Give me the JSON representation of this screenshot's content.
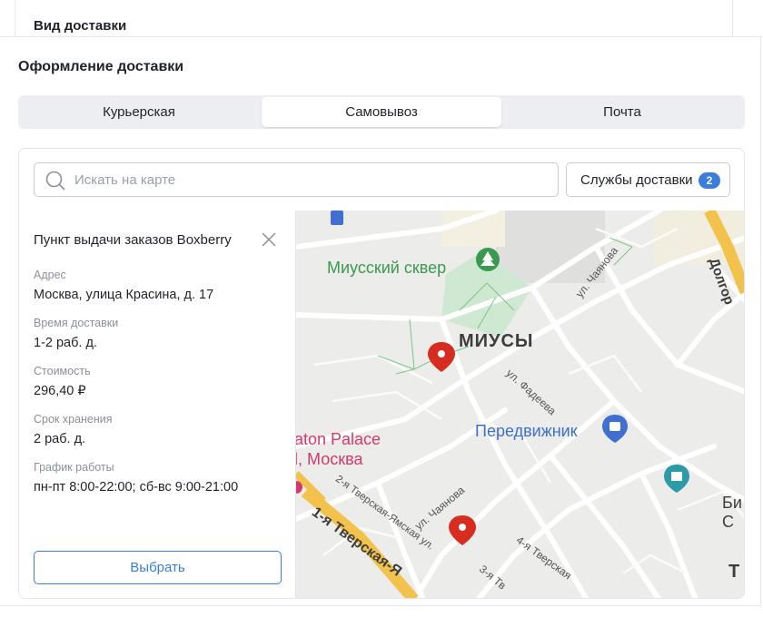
{
  "delivery_type_label": "Вид доставки",
  "section_title": "Оформление доставки",
  "tabs": [
    {
      "label": "Курьерская",
      "active": false
    },
    {
      "label": "Самовывоз",
      "active": true
    },
    {
      "label": "Почта",
      "active": false
    }
  ],
  "search": {
    "placeholder": "Искать на карте",
    "value": ""
  },
  "services_button": {
    "label": "Службы доставки",
    "count": "2"
  },
  "pickup": {
    "title": "Пункт выдачи заказов Boxberry",
    "fields": [
      {
        "label": "Адрес",
        "value": "Москва, улица Красина, д. 17"
      },
      {
        "label": "Время доставки",
        "value": "1-2 раб. д."
      },
      {
        "label": "Стоимость",
        "value": "296,40 ₽"
      },
      {
        "label": "Срок хранения",
        "value": "2 раб. д."
      },
      {
        "label": "График работы",
        "value": "пн-пт 8:00-22:00; сб-вс 9:00-21:00"
      }
    ],
    "choose_label": "Выбрать"
  },
  "map": {
    "labels": {
      "park": "Миусский сквер",
      "district": "МИУСЫ",
      "chayanova_1": "ул. Чаянова",
      "fadeeva": "ул. Фадеева",
      "store": "Передвижник",
      "hotel_1": "aton Palace",
      "hotel_2": "l, Москва",
      "tverskaya_2": "2-я Тверская-Ямская ул.",
      "chayanova_2": "ул. Чаянова",
      "tverskaya_1": "1-я Тверская-Я",
      "tverskaya_4": "4-я Тверская",
      "tverskaya_3": "3-я Тв",
      "dolgor": "Долгор",
      "bi_1": "Би",
      "bi_2": "С",
      "t": "Т"
    },
    "colors": {
      "park_green": "#3a9a4f",
      "marker_red": "#d62d20",
      "store_blue": "#3f6fd1",
      "hotel_pink": "#d23a6e",
      "museum_teal": "#2c9aa8",
      "main_road": "#f3c24d"
    }
  },
  "accent_color": "#3b7ddd"
}
